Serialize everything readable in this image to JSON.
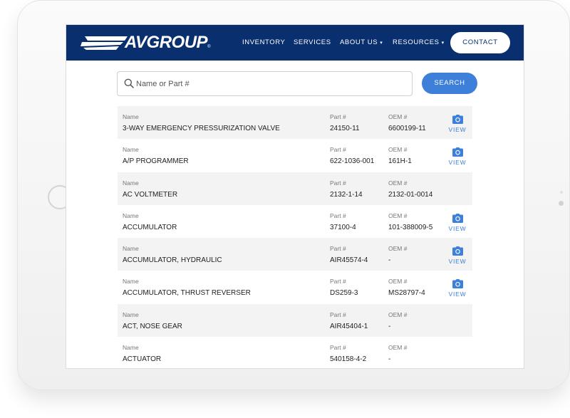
{
  "brand": {
    "name": "AVGROUP",
    "reg": "®"
  },
  "nav": {
    "items": [
      {
        "label": "INVENTORY",
        "dropdown": false
      },
      {
        "label": "SERVICES",
        "dropdown": false
      },
      {
        "label": "ABOUT US",
        "dropdown": true
      },
      {
        "label": "RESOURCES",
        "dropdown": true
      }
    ],
    "contact_label": "CONTACT"
  },
  "search": {
    "placeholder": "Name or Part #",
    "value": "",
    "button_label": "SEARCH"
  },
  "columns": {
    "name": "Name",
    "part": "Part #",
    "oem": "OEM #"
  },
  "view_label": "VIEW",
  "rows": [
    {
      "name": "3-WAY EMERGENCY PRESSURIZATION VALVE",
      "part": "24150-11",
      "oem": "6600199-11",
      "has_view": true
    },
    {
      "name": "A/P PROGRAMMER",
      "part": "622-1036-001",
      "oem": "161H-1",
      "has_view": true
    },
    {
      "name": "AC VOLTMETER",
      "part": "2132-1-14",
      "oem": "2132-01-0014",
      "has_view": false
    },
    {
      "name": "ACCUMULATOR",
      "part": "37100-4",
      "oem": "101-388009-5",
      "has_view": true
    },
    {
      "name": "ACCUMULATOR, HYDRAULIC",
      "part": "AIR45574-4",
      "oem": "-",
      "has_view": true
    },
    {
      "name": "ACCUMULATOR, THRUST REVERSER",
      "part": "DS259-3",
      "oem": "MS28797-4",
      "has_view": true
    },
    {
      "name": "ACT, NOSE GEAR",
      "part": "AIR45404-1",
      "oem": "-",
      "has_view": false
    },
    {
      "name": "ACTUATOR",
      "part": "540158-4-2",
      "oem": "-",
      "has_view": false
    }
  ],
  "colors": {
    "navbar": "#0a2f6e",
    "accent": "#3d7fd9",
    "row_shade": "#f3f3f3"
  },
  "icons": {
    "search": "search-icon",
    "view": "camera-icon",
    "dropdown": "caret-down-icon"
  }
}
